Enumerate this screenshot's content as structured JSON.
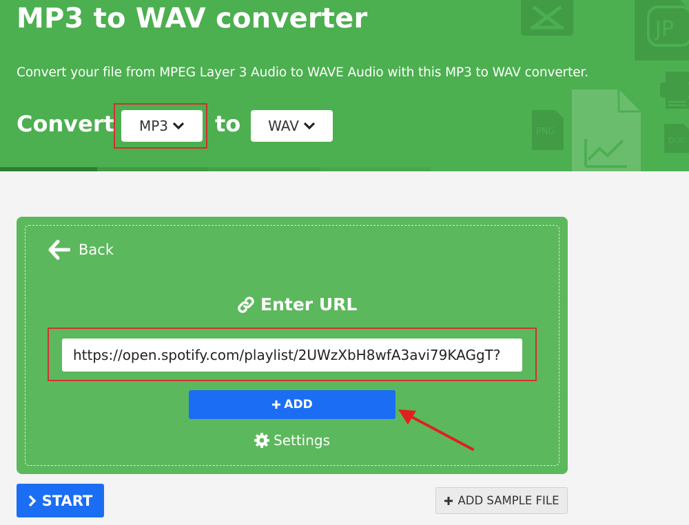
{
  "header": {
    "title": "MP3 to WAV converter",
    "subtitle": "Convert your file from MPEG Layer 3 Audio to WAVE Audio with this MP3 to WAV converter.",
    "convert_label": "Convert",
    "to_label": "to",
    "from_format": "MP3",
    "to_format": "WAV",
    "bg_icon_labels": [
      "JP",
      "PNG",
      "DOC"
    ]
  },
  "card": {
    "back_label": "Back",
    "enter_url_label": "Enter URL",
    "url_value": "https://open.spotify.com/playlist/2UWzXbH8wfA3avi79KAGgT?",
    "add_label": "ADD",
    "settings_label": "Settings"
  },
  "footer": {
    "start_label": "START",
    "add_sample_label": "ADD SAMPLE FILE"
  },
  "colors": {
    "header_green": "#4caf50",
    "card_green": "#5cb85c",
    "primary_blue": "#1b6ef3",
    "highlight_red": "#d32f2f"
  }
}
